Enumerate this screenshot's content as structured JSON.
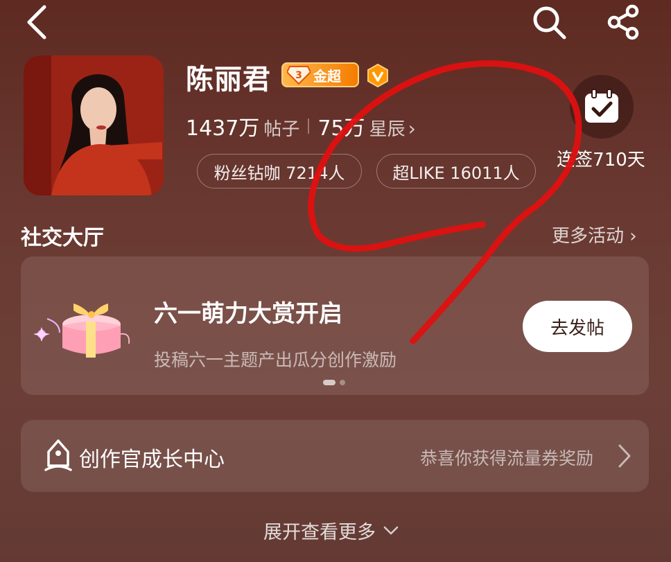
{
  "header": {
    "back_icon": "chevron-left-icon",
    "search_icon": "search-icon",
    "share_icon": "share-icon"
  },
  "profile": {
    "name": "陈丽君",
    "badge_label": "金超",
    "badge_level": "3",
    "verified_icon": "verified-v-icon",
    "posts_count": "1437万",
    "posts_unit": "帖子",
    "stars_count": "75万",
    "stars_unit": "星辰",
    "fans_pill": "粉丝钻咖 7214人",
    "superlike_pill": "超LIKE 16011人",
    "checkin_text": "连签710天"
  },
  "social": {
    "title": "社交大厅",
    "more_label": "更多活动"
  },
  "banner": {
    "title": "六一萌力大赏开启",
    "subtitle": "投稿六一主题产出瓜分创作激励",
    "button_label": "去发帖",
    "page_index": 1,
    "page_total": 2
  },
  "growth": {
    "label": "创作官成长中心",
    "right_text": "恭喜你获得流量券奖励"
  },
  "footer": {
    "expand_label": "展开查看更多"
  },
  "colors": {
    "background": "#652f27",
    "badge_gold": "#f57c00",
    "verified": "#ff9800",
    "annotation_red": "#e01010"
  }
}
